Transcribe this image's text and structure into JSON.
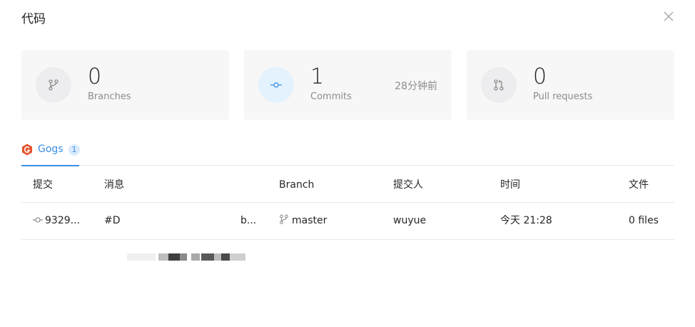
{
  "dialog": {
    "title": "代码"
  },
  "stats": [
    {
      "value": "0",
      "label": "Branches",
      "icon": "branch-icon"
    },
    {
      "value": "1",
      "label": "Commits",
      "icon": "commit-icon",
      "extra": "28分钟前"
    },
    {
      "value": "0",
      "label": "Pull requests",
      "icon": "pull-request-icon"
    }
  ],
  "tabs": [
    {
      "label": "Gogs",
      "count": "1",
      "icon": "gogs-icon"
    }
  ],
  "table": {
    "headers": [
      "提交",
      "消息",
      "Branch",
      "提交人",
      "时间",
      "文件"
    ],
    "rows": [
      {
        "sha": "9329...",
        "message_start": "#D",
        "message_end": "b...",
        "branch": "master",
        "author": "wuyue",
        "time": "今天 21:28",
        "files": "0 files"
      }
    ]
  },
  "colors": {
    "accent": "#3b8ee6",
    "gogs": "#e5542e",
    "card_bg": "#f7f7f8",
    "muted": "#8c8c8c"
  }
}
